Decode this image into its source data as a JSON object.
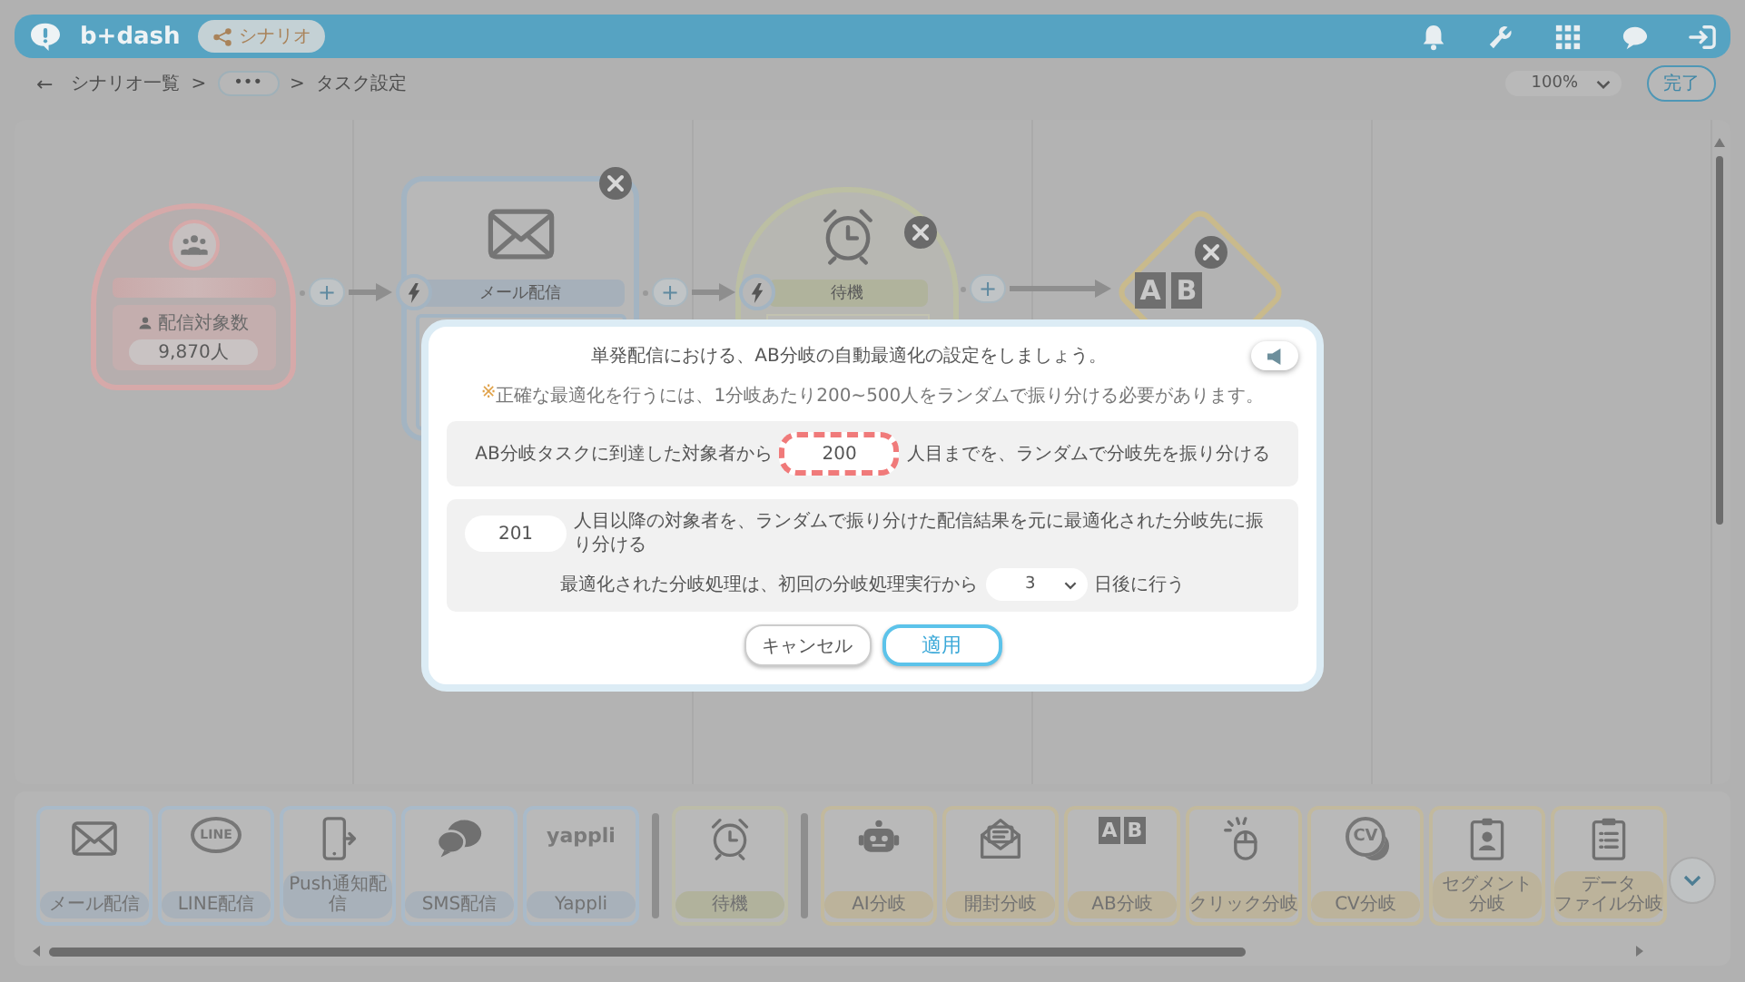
{
  "header": {
    "logo": "b+dash",
    "badge": "シナリオ"
  },
  "breadcrumb": {
    "back": "←",
    "items": [
      {
        "label": "シナリオ一覧",
        "kind": "link"
      },
      {
        "label": ">",
        "kind": "separator"
      },
      {
        "label": "•••",
        "kind": "more"
      },
      {
        "label": ">",
        "kind": "separator"
      },
      {
        "label": "タスク設定",
        "kind": "current"
      }
    ]
  },
  "zoom": {
    "value": "100%"
  },
  "done_button": "完了",
  "canvas": {
    "nodes": [
      {
        "kind": "segment",
        "label": "配信対象数",
        "count": "9,870人",
        "closable": false
      },
      {
        "kind": "mail",
        "label": "メール配信",
        "closable": true
      },
      {
        "kind": "wait",
        "label": "待機",
        "closable": true
      },
      {
        "kind": "ab",
        "icon_letters": [
          "A",
          "B"
        ],
        "closable": true
      }
    ],
    "connectors": [
      {
        "add": "+",
        "trigger": true
      },
      {
        "add": "+",
        "trigger": true
      },
      {
        "add": "+",
        "trigger": false
      }
    ]
  },
  "modal": {
    "title": "単発配信における、AB分岐の自動最適化の設定をしましょう。",
    "note_mark": "※",
    "note": "正確な最適化を行うには、1分岐あたり200~500人をランダムで振り分ける必要があります。",
    "sections": [
      {
        "rows": [
          {
            "before": "AB分岐タスクに到達した対象者から",
            "input": {
              "value": "200",
              "highlighted": true
            },
            "after": "人目までを、ランダムで分岐先を振り分ける"
          }
        ]
      },
      {
        "rows": [
          {
            "input": {
              "value": "201",
              "highlighted": false
            },
            "after": "人目以降の対象者を、ランダムで振り分けた配信結果を元に最適化された分岐先に振り分ける"
          },
          {
            "before": "最適化された分岐処理は、初回の分岐処理実行から",
            "select": {
              "value": "3"
            },
            "after": "日後に行う"
          }
        ]
      }
    ],
    "buttons": [
      {
        "label": "キャンセル",
        "primary": false
      },
      {
        "label": "適用",
        "primary": true
      }
    ]
  },
  "palette": {
    "items": [
      {
        "label": "メール配信",
        "kind": "delivery"
      },
      {
        "label": "LINE配信",
        "kind": "delivery",
        "icon_text": "LINE"
      },
      {
        "label": "Push通知配信",
        "kind": "delivery"
      },
      {
        "label": "SMS配信",
        "kind": "delivery"
      },
      {
        "label": "Yappli",
        "kind": "delivery",
        "icon_text": "yappli"
      },
      {
        "label": "待機",
        "kind": "wait"
      },
      {
        "label": "AI分岐",
        "kind": "branch"
      },
      {
        "label": "開封分岐",
        "kind": "branch"
      },
      {
        "label": "AB分岐",
        "kind": "branch",
        "icon_letters": [
          "A",
          "B"
        ]
      },
      {
        "label": "クリック分岐",
        "kind": "branch"
      },
      {
        "label": "CV分岐",
        "kind": "branch",
        "icon_text": "CV"
      },
      {
        "label_lines": [
          "セグメント",
          "分岐"
        ],
        "kind": "branch"
      },
      {
        "label_lines": [
          "データ",
          "ファイル分岐"
        ],
        "kind": "branch"
      }
    ]
  }
}
